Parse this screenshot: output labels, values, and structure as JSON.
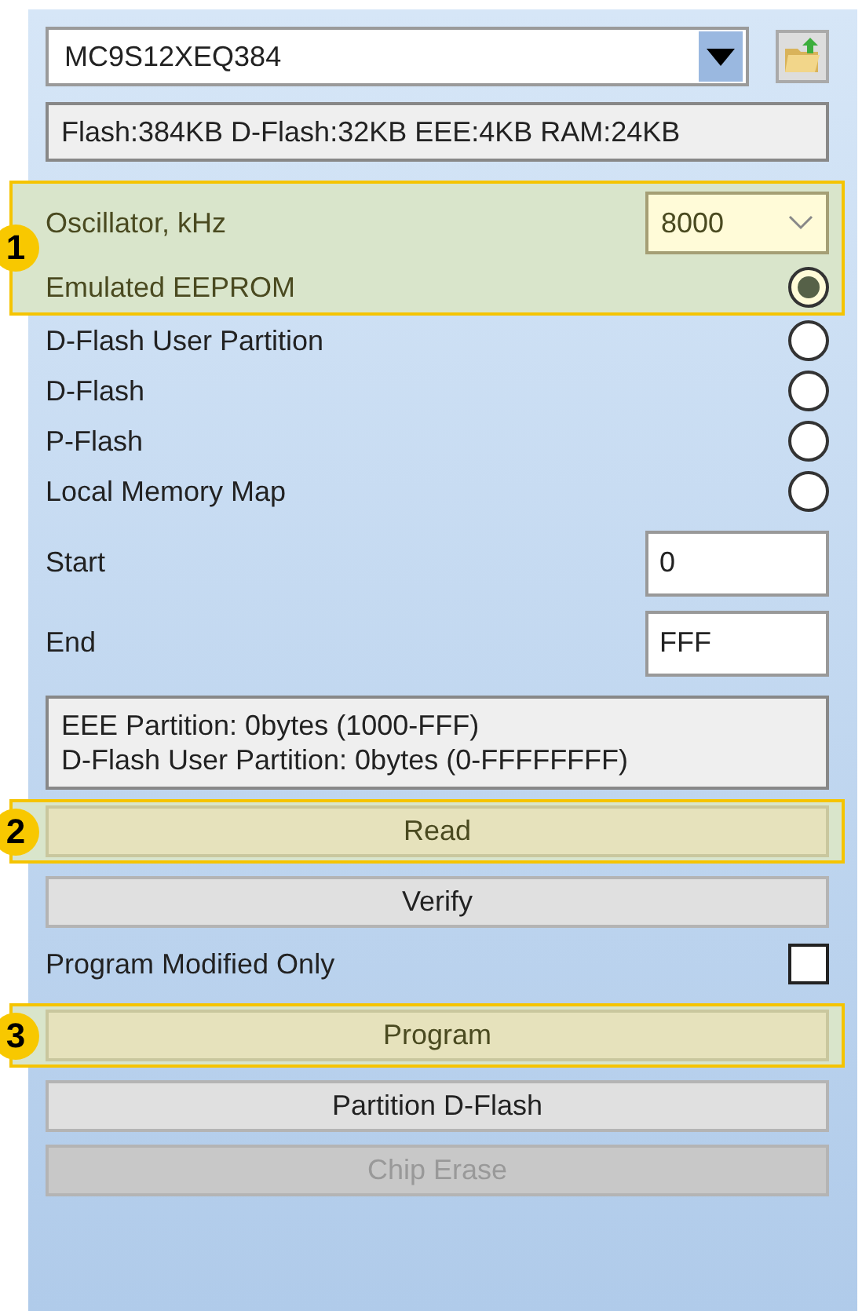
{
  "device": {
    "value": "MC9S12XEQ384"
  },
  "memory_info": "Flash:384KB D-Flash:32KB EEE:4KB RAM:24KB",
  "oscillator": {
    "label": "Oscillator, kHz",
    "value": "8000",
    "highlighted": true,
    "callout": "1"
  },
  "memory_options": [
    {
      "label": "Emulated EEPROM",
      "selected": true,
      "highlighted": true
    },
    {
      "label": "D-Flash User Partition",
      "selected": false,
      "highlighted": false
    },
    {
      "label": "D-Flash",
      "selected": false,
      "highlighted": false
    },
    {
      "label": "P-Flash",
      "selected": false,
      "highlighted": false
    },
    {
      "label": "Local Memory Map",
      "selected": false,
      "highlighted": false
    }
  ],
  "range": [
    {
      "label": "Start",
      "value": "0"
    },
    {
      "label": "End",
      "value": "FFF"
    }
  ],
  "partition_info": [
    "EEE Partition: 0bytes (1000-FFF)",
    "D-Flash User Partition: 0bytes (0-FFFFFFFF)"
  ],
  "actions": [
    {
      "kind": "button",
      "label": "Read",
      "disabled": false,
      "highlighted": true,
      "callout": "2"
    },
    {
      "kind": "button",
      "label": "Verify",
      "disabled": false,
      "highlighted": false
    },
    {
      "kind": "checkbox",
      "label": "Program Modified Only",
      "checked": false
    },
    {
      "kind": "button",
      "label": "Program",
      "disabled": false,
      "highlighted": true,
      "callout": "3"
    },
    {
      "kind": "button",
      "label": "Partition D-Flash",
      "disabled": false,
      "highlighted": false
    },
    {
      "kind": "button",
      "label": "Chip Erase",
      "disabled": true,
      "highlighted": false
    }
  ]
}
